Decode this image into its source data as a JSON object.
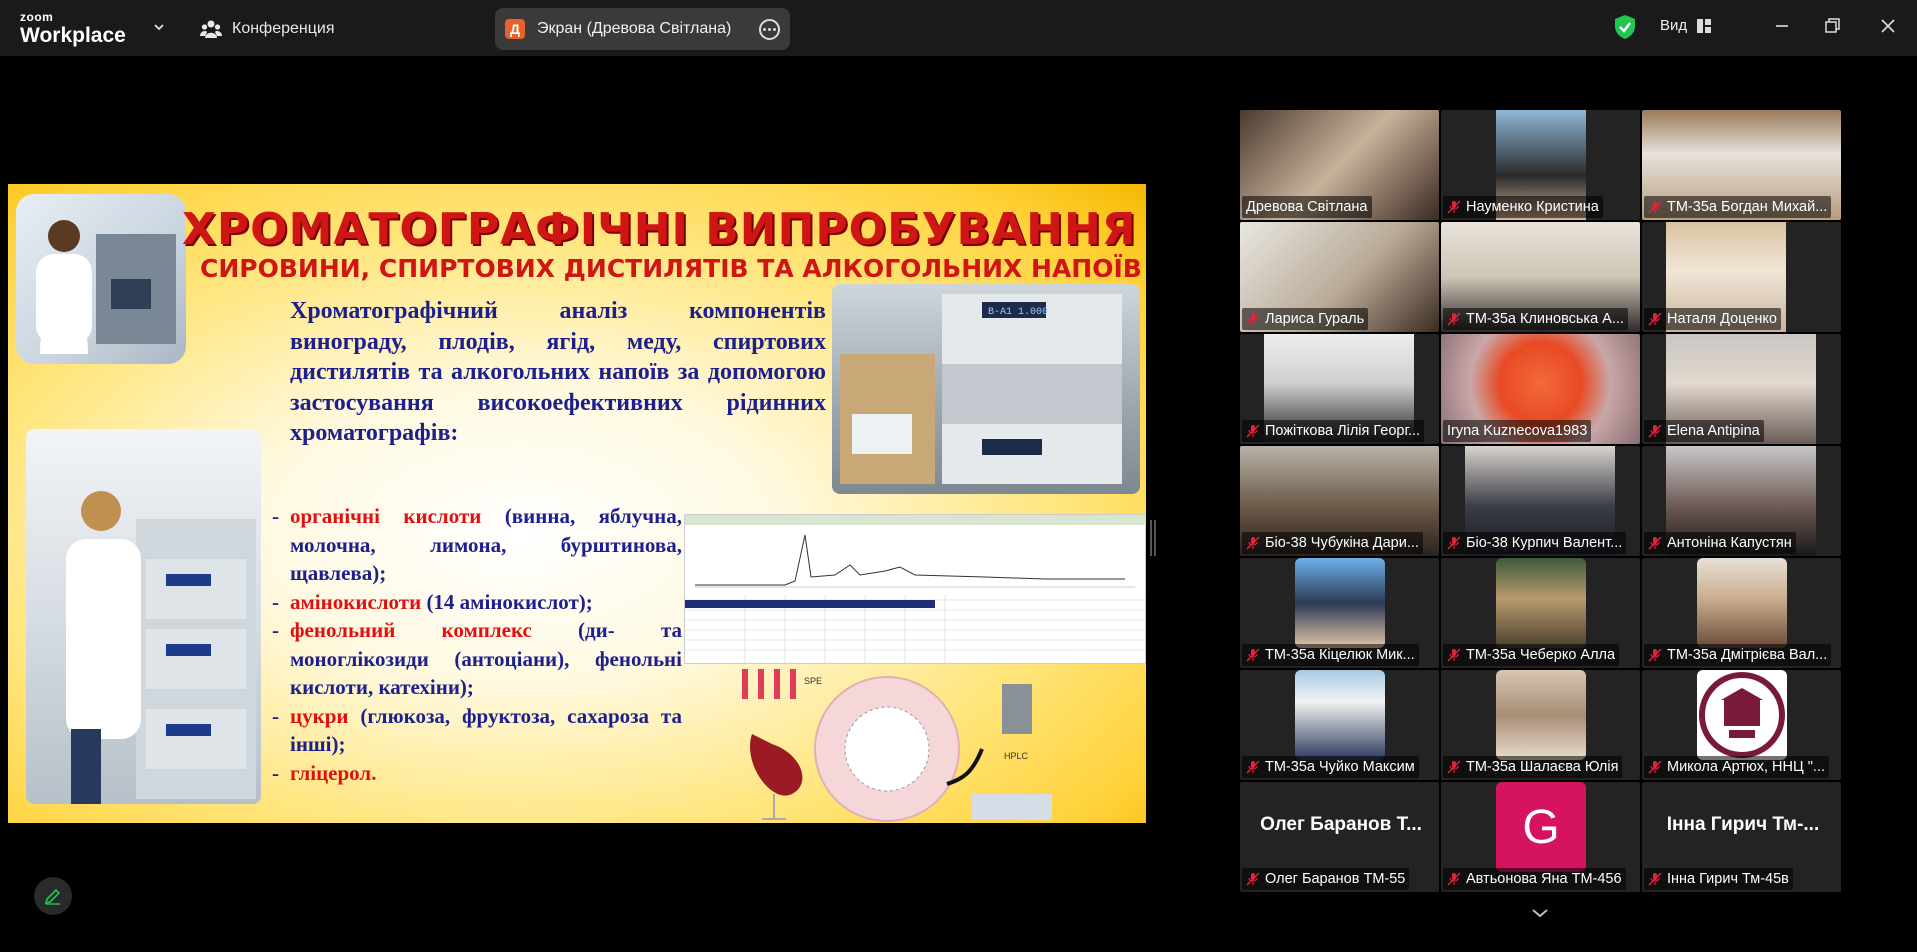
{
  "app": {
    "logo_small": "zoom",
    "logo_big": "Workplace"
  },
  "topbar": {
    "meeting_label": "Конференция",
    "screen_share_initial": "Д",
    "screen_share_label": "Экран (Древова Світлана)",
    "view_label": "Вид"
  },
  "colors": {
    "active_speaker": "#23d96b",
    "muted_mic": "#e0243a",
    "share_avatar": "#e8612c",
    "security_shield": "#23c552"
  },
  "slide": {
    "title": "ХРОМАТОГРАФІЧНІ ВИПРОБУВАННЯ",
    "subtitle": "СИРОВИНИ, СПИРТОВИХ ДИСТИЛЯТІВ ТА АЛКОГОЛЬНИХ НАПОЇВ",
    "intro": "Хроматографічний аналіз компонентів винограду, плодів, ягід, меду, спиртових дистилятів та алкогольних напоїв за допомогою застосування високоефективних рідинних хроматографів:",
    "items": [
      {
        "term": "органічні кислоти",
        "rest": " (винна, яблучна, молочна, лимона, бурштинова, щавлева);"
      },
      {
        "term": "амінокислоти",
        "rest": " (14 амінокислот);"
      },
      {
        "term": "фенольний комплекс",
        "rest": " (ди- та моноглікозиди (антоціани), фенольні кислоти, катехіни);"
      },
      {
        "term": "цукри",
        "rest": " (глюкоза, фруктоза, сахароза та інші);"
      },
      {
        "term": "гліцерол.",
        "rest": ""
      }
    ],
    "scheme_labels": {
      "spe": "SPE",
      "hplc": "HPLC"
    },
    "instrument_display_1": "B-A1  1.000"
  },
  "participants": [
    {
      "name": "Древова Світлана",
      "muted": false,
      "active": true,
      "kind": "video"
    },
    {
      "name": "Науменко Кристина",
      "muted": true,
      "active": false,
      "kind": "video-narrow"
    },
    {
      "name": "ТМ-35а Богдан Михай...",
      "muted": true,
      "active": false,
      "kind": "video"
    },
    {
      "name": "Лариса Гураль",
      "muted": true,
      "active": false,
      "kind": "video"
    },
    {
      "name": "ТМ-35а Клиновська А...",
      "muted": true,
      "active": false,
      "kind": "video"
    },
    {
      "name": "Наталя Доценко",
      "muted": true,
      "active": false,
      "kind": "video-narrow"
    },
    {
      "name": "Пожіткова Лілія Георг...",
      "muted": true,
      "active": false,
      "kind": "video-narrow"
    },
    {
      "name": "Iryna Kuznecova1983",
      "muted": false,
      "active": false,
      "kind": "video"
    },
    {
      "name": "Elena Antipina",
      "muted": true,
      "active": false,
      "kind": "video-narrow"
    },
    {
      "name": "Біо-38 Чубукіна Дари...",
      "muted": true,
      "active": false,
      "kind": "video"
    },
    {
      "name": "Біо-38 Курпич Валент...",
      "muted": true,
      "active": false,
      "kind": "video-narrow"
    },
    {
      "name": "Антоніна Капустян",
      "muted": true,
      "active": false,
      "kind": "video-narrow"
    },
    {
      "name": "ТМ-35а Кіцелюк Мик...",
      "muted": true,
      "active": false,
      "kind": "photo"
    },
    {
      "name": "ТМ-35а Чеберко Алла",
      "muted": true,
      "active": false,
      "kind": "photo"
    },
    {
      "name": "ТМ-35а Дмітрієва Вал...",
      "muted": true,
      "active": false,
      "kind": "photo"
    },
    {
      "name": "ТМ-35а Чуйко Максим",
      "muted": true,
      "active": false,
      "kind": "photo"
    },
    {
      "name": "ТМ-35а Шалаєва Юлія",
      "muted": true,
      "active": false,
      "kind": "photo"
    },
    {
      "name": "Микола Артюх, ННЦ \"...",
      "muted": true,
      "active": false,
      "kind": "logo"
    },
    {
      "name": "Олег Баранов ТМ-55",
      "muted": true,
      "active": false,
      "kind": "noname",
      "bigname": "Олег  Баранов  Т..."
    },
    {
      "name": "Автьонова Яна ТМ-456",
      "muted": true,
      "active": false,
      "kind": "initial",
      "initial": "G"
    },
    {
      "name": "Інна Гирич Тм-45в",
      "muted": true,
      "active": false,
      "kind": "noname",
      "bigname": "Інна Гирич Тм-..."
    }
  ]
}
